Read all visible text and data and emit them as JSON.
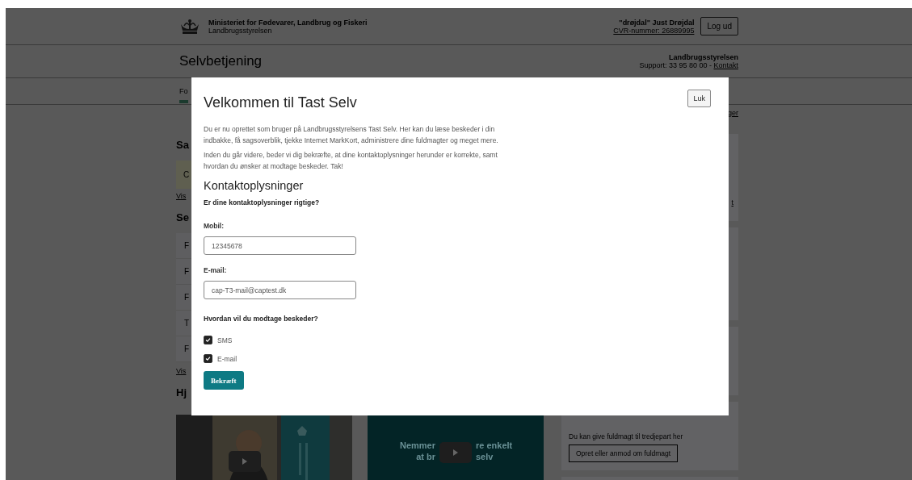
{
  "header": {
    "ministry": "Ministeriet for Fødevarer, Landbrug og Fiskeri",
    "agency": "Landbrugsstyrelsen",
    "user": "\"drøjdal\" Just Drøjdal",
    "cvr": "CVR-nummer: 26889995",
    "logout": "Log ud"
  },
  "subheader": {
    "title": "Selvbetjening",
    "org": "Landbrugsstyrelsen",
    "support": "Support: 33 95 80 00 -",
    "contact": "Kontakt"
  },
  "nav": {
    "tabs": [
      {
        "label": "Fo",
        "selected": true
      }
    ],
    "right_link": "ger"
  },
  "main": [
    {
      "kind": "heading",
      "text": "Sa"
    },
    {
      "kind": "notice",
      "text": "C"
    },
    {
      "kind": "link",
      "text": "Vis"
    },
    {
      "kind": "heading",
      "text": "Se"
    },
    {
      "kind": "list",
      "items": [
        "F",
        "F",
        "F",
        "T",
        "F"
      ]
    },
    {
      "kind": "link",
      "text": "Vis"
    },
    {
      "kind": "heading",
      "text": "Hj"
    }
  ],
  "videos": [
    {
      "kind": "picture"
    },
    {
      "kind": "promo",
      "lines": [
        [
          "Nemmer",
          "re enkelt"
        ],
        [
          "at br",
          "selv"
        ]
      ]
    }
  ],
  "cards": [
    {
      "kind": "link",
      "text": "t"
    },
    {
      "kind": "blank"
    },
    {
      "kind": "blank"
    },
    {
      "kind": "fuldmagt",
      "text": "Du kan give fuldmagt til tredjepart her",
      "button": "Opret eller anmod om fuldmagt"
    },
    {
      "kind": "blank"
    }
  ],
  "modal": {
    "title": "Velkommen til Tast Selv",
    "close": "Luk",
    "paragraphs": [
      "Du er nu oprettet som bruger på Landbrugsstyrelsens Tast Selv. Her kan du læse beskeder i din indbakke, få sagsoverblik, tjekke Internet MarkKort, administrere dine fuldmagter og meget mere.",
      "Inden du går videre, beder vi dig bekræfte, at dine kontaktoplysninger herunder er korrekte, samt hvordan du ønsker at modtage beskeder. Tak!"
    ],
    "section": "Kontaktoplysninger",
    "question": "Er dine kontaktoplysninger rigtige?",
    "fields": [
      {
        "label": "Mobil:",
        "value": "12345678"
      },
      {
        "label": "E-mail:",
        "value": "cap-T3-mail@captest.dk"
      }
    ],
    "channels_question": "Hvordan vil du modtage beskeder?",
    "options": [
      {
        "label": "SMS",
        "checked": true
      },
      {
        "label": "E-mail",
        "checked": true
      }
    ],
    "submit": "Bekræft"
  }
}
